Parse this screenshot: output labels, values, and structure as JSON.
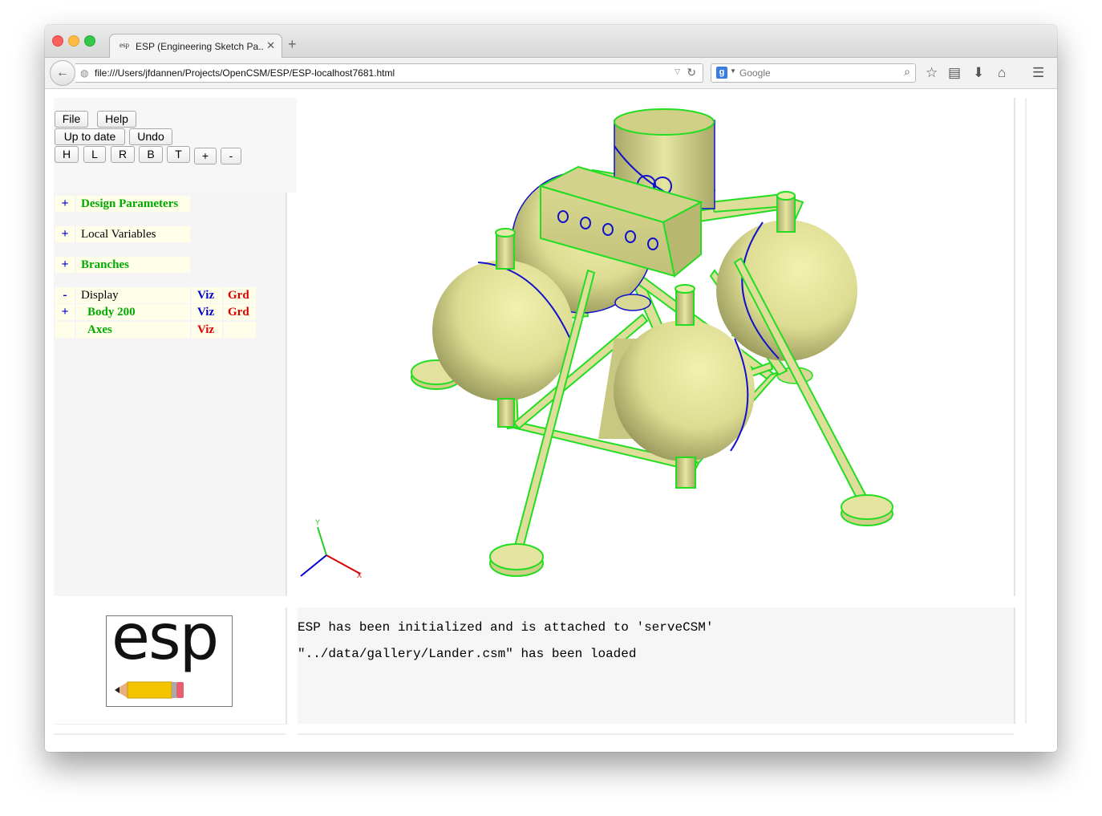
{
  "browser": {
    "tab_title": "ESP (Engineering Sketch Pa...",
    "tab_favicon": "esp",
    "url": "file:///Users/jfdannen/Projects/OpenCSM/ESP/ESP-localhost7681.html",
    "search_placeholder": "Google",
    "new_tab_label": "+",
    "icons": [
      "back-arrow-icon",
      "globe-icon",
      "reload-icon",
      "google-icon",
      "search-icon",
      "bookmark-star-icon",
      "reading-list-icon",
      "download-icon",
      "home-icon",
      "menu-icon"
    ]
  },
  "toolbar": {
    "file": "File",
    "help": "Help",
    "uptodate": "Up to date",
    "undo": "Undo",
    "views": [
      "H",
      "L",
      "R",
      "B",
      "T",
      "+",
      "-"
    ]
  },
  "tree": {
    "design_parameters": {
      "toggle": "+",
      "label": "Design Parameters"
    },
    "local_variables": {
      "toggle": "+",
      "label": "Local Variables"
    },
    "branches": {
      "toggle": "+",
      "label": "Branches"
    },
    "display": {
      "toggle": "-",
      "label": "Display",
      "viz": "Viz",
      "grd": "Grd"
    },
    "body200": {
      "toggle": "+",
      "label": "Body 200",
      "viz": "Viz",
      "grd": "Grd"
    },
    "axes": {
      "label": "Axes",
      "viz": "Viz"
    }
  },
  "axes_labels": {
    "y": "Y",
    "x": "X"
  },
  "messages": [
    "ESP has been initialized and is attached to 'serveCSM'",
    "\"../data/gallery/Lander.csm\" has been loaded"
  ],
  "logo_text": "esp",
  "colors": {
    "green_label": "#00aa00",
    "blue_label": "#0000cc",
    "red_label": "#dd0000",
    "body_fill": "#e5e59a",
    "edge_green": "#22dd22",
    "edge_blue": "#1111cc"
  }
}
